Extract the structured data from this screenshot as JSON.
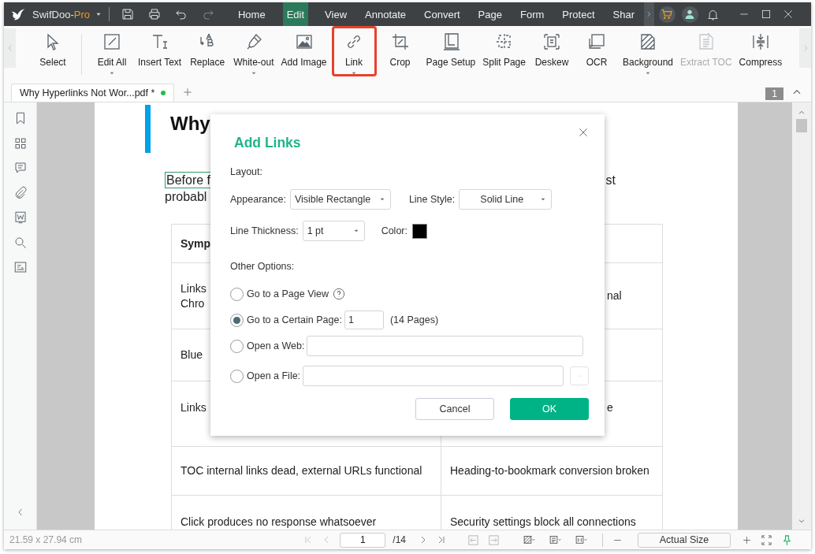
{
  "window": {
    "app_name": "SwifDoo-",
    "app_edition": "Pro"
  },
  "menu_tabs": [
    {
      "label": "Home",
      "selected": false
    },
    {
      "label": "Edit",
      "selected": true
    },
    {
      "label": "View",
      "selected": false
    },
    {
      "label": "Annotate",
      "selected": false
    },
    {
      "label": "Convert",
      "selected": false
    },
    {
      "label": "Page",
      "selected": false
    },
    {
      "label": "Form",
      "selected": false
    },
    {
      "label": "Protect",
      "selected": false
    },
    {
      "label": "Shar",
      "selected": false
    }
  ],
  "toolbar": [
    {
      "label": "Select",
      "dropdown": false,
      "disabled": false,
      "highlighted": false
    },
    {
      "label": "Edit All",
      "dropdown": true,
      "disabled": false,
      "highlighted": false,
      "divider_before": true
    },
    {
      "label": "Insert Text",
      "dropdown": false,
      "disabled": false,
      "highlighted": false
    },
    {
      "label": "Replace",
      "dropdown": false,
      "disabled": false,
      "highlighted": false
    },
    {
      "label": "White-out",
      "dropdown": true,
      "disabled": false,
      "highlighted": false
    },
    {
      "label": "Add Image",
      "dropdown": false,
      "disabled": false,
      "highlighted": false
    },
    {
      "label": "Link",
      "dropdown": true,
      "disabled": false,
      "highlighted": true
    },
    {
      "label": "Crop",
      "dropdown": false,
      "disabled": false,
      "highlighted": false
    },
    {
      "label": "Page Setup",
      "dropdown": false,
      "disabled": false,
      "highlighted": false
    },
    {
      "label": "Split Page",
      "dropdown": false,
      "disabled": false,
      "highlighted": false
    },
    {
      "label": "Deskew",
      "dropdown": false,
      "disabled": false,
      "highlighted": false
    },
    {
      "label": "OCR",
      "dropdown": false,
      "disabled": false,
      "highlighted": false
    },
    {
      "label": "Background",
      "dropdown": true,
      "disabled": false,
      "highlighted": false
    },
    {
      "label": "Extract TOC",
      "dropdown": false,
      "disabled": true,
      "highlighted": false
    },
    {
      "label": "Compress",
      "dropdown": false,
      "disabled": false,
      "highlighted": false
    }
  ],
  "document_tab": {
    "title": "Why Hyperlinks Not Wor...pdf *",
    "modified": true,
    "page_badge": "1"
  },
  "document": {
    "heading": "Why",
    "paragraph": {
      "line1_start": "Before f",
      "line1_end": "st",
      "line2": "probabl"
    },
    "table_rows": [
      {
        "header": true,
        "cells": [
          {
            "text": "Symp",
            "tail": false
          }
        ]
      },
      {
        "header": false,
        "cells": [
          {
            "text": "Links\nChro",
            "tail": false
          },
          {
            "text": "nal",
            "tail": true
          }
        ]
      },
      {
        "header": false,
        "cells": [
          {
            "text": "Blue",
            "tail": false
          }
        ]
      },
      {
        "header": false,
        "cells": [
          {
            "text": "Links",
            "tail": false
          },
          {
            "text": "e",
            "tail": true
          }
        ]
      },
      {
        "header": false,
        "cells": [
          {
            "text": "TOC internal links dead, external URLs functional",
            "tail": false
          },
          {
            "text": "Heading-to-bookmark conversion broken",
            "tail": false
          }
        ]
      },
      {
        "header": false,
        "cells": [
          {
            "text": "Click produces no response whatsoever",
            "tail": false
          },
          {
            "text": "Security settings block all connections",
            "tail": false
          }
        ]
      }
    ]
  },
  "dialog": {
    "title": "Add Links",
    "layout_label": "Layout:",
    "appearance": {
      "label": "Appearance:",
      "value": "Visible Rectangle"
    },
    "line_style": {
      "label": "Line Style:",
      "value": "Solid Line"
    },
    "line_thickness": {
      "label": "Line Thickness:",
      "value": "1 pt"
    },
    "color": {
      "label": "Color:",
      "color": "#000000"
    },
    "other_label": "Other Options:",
    "options": [
      {
        "kind": "page_view",
        "label": "Go to a Page View",
        "selected": false
      },
      {
        "kind": "page",
        "label": "Go to a Certain Page:",
        "selected": true,
        "value": "1",
        "note": "(14 Pages)"
      },
      {
        "kind": "web",
        "label": "Open a Web:",
        "selected": false
      },
      {
        "kind": "file",
        "label": "Open a File:",
        "selected": false
      }
    ],
    "buttons": [
      {
        "label": "Cancel",
        "primary": false
      },
      {
        "label": "OK",
        "primary": true
      }
    ]
  },
  "status_bar": {
    "page_size": "21.59 x 27.94 cm",
    "page_input": "1",
    "page_total": "/14",
    "zoom": "Actual Size"
  }
}
